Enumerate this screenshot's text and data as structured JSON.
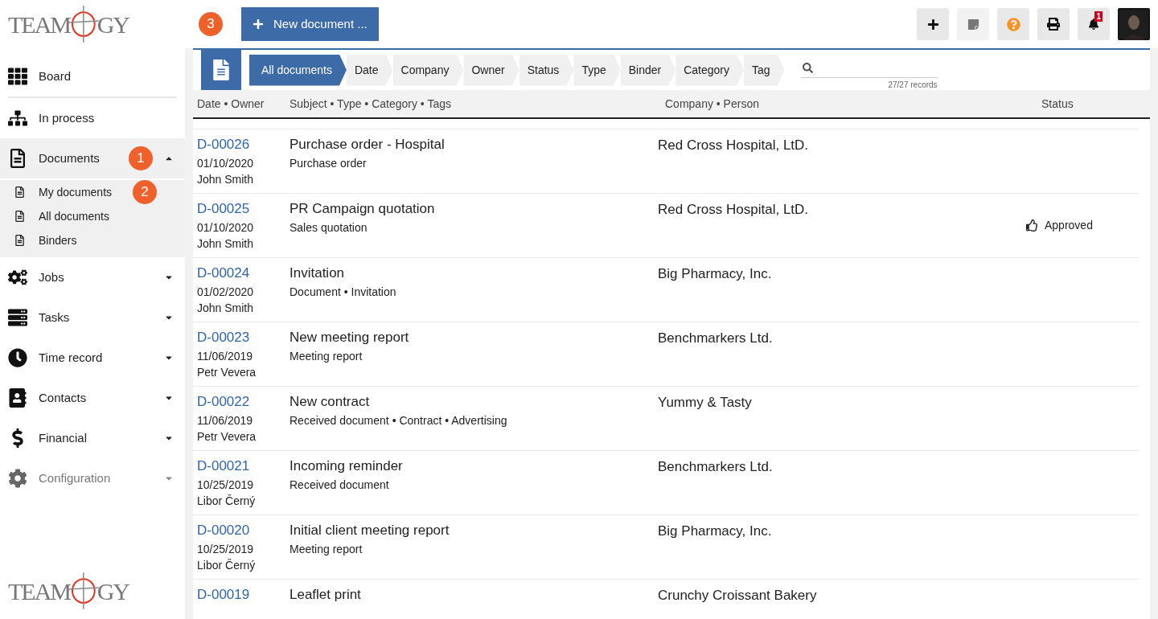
{
  "logo": {
    "left": "TEAM",
    "right": "GY"
  },
  "sidebar": {
    "items": [
      {
        "label": "Board",
        "selected": false
      },
      {
        "label": "In process",
        "selected": false
      },
      {
        "label": "Documents",
        "selected": true,
        "expanded": true,
        "badge": "1",
        "children": [
          {
            "label": "My documents",
            "badge": "2"
          },
          {
            "label": "All documents"
          },
          {
            "label": "Binders"
          }
        ]
      },
      {
        "label": "Jobs",
        "selected": false,
        "expanded": false
      },
      {
        "label": "Tasks",
        "selected": false,
        "expanded": false
      },
      {
        "label": "Time record",
        "selected": false,
        "expanded": false
      },
      {
        "label": "Contacts",
        "selected": false,
        "expanded": false
      },
      {
        "label": "Financial",
        "selected": false,
        "expanded": false
      },
      {
        "label": "Configuration",
        "selected": false,
        "expanded": false,
        "disabled": true
      }
    ]
  },
  "footer_logo": {
    "left": "TEAM",
    "right": "GY"
  },
  "toolbar": {
    "badge": "3",
    "new_button": "New document ...",
    "notifications": "1"
  },
  "filters": [
    {
      "label": "All documents",
      "selected": true
    },
    {
      "label": "Date",
      "selected": false
    },
    {
      "label": "Company",
      "selected": false
    },
    {
      "label": "Owner",
      "selected": false
    },
    {
      "label": "Status",
      "selected": false
    },
    {
      "label": "Type",
      "selected": false
    },
    {
      "label": "Binder",
      "selected": false
    },
    {
      "label": "Category",
      "selected": false
    },
    {
      "label": "Tag",
      "selected": false
    }
  ],
  "records": "27/27 records",
  "table": {
    "columns": [
      "Date • Owner",
      "Subject • Type • Category • Tags",
      "Company • Person",
      "Status"
    ],
    "rows": [
      {
        "id": "D-00026",
        "date": "01/10/2020",
        "owner": "John Smith",
        "subject": "Purchase order - Hospital",
        "type": "Purchase order",
        "company": "Red Cross Hospital, LtD."
      },
      {
        "id": "D-00025",
        "date": "01/10/2020",
        "owner": "John Smith",
        "subject": "PR Campaign quotation",
        "type": "Sales quotation",
        "company": "Red Cross Hospital, LtD.",
        "status": {
          "kind": "approved",
          "label": "Approved"
        }
      },
      {
        "id": "D-00024",
        "date": "01/02/2020",
        "owner": "John Smith",
        "subject": "Invitation",
        "type": "Document • Invitation",
        "company": "Big Pharmacy, Inc."
      },
      {
        "id": "D-00023",
        "date": "11/06/2019",
        "owner": "Petr Vevera",
        "subject": "New meeting report",
        "type": "Meeting report",
        "company": "Benchmarkers Ltd."
      },
      {
        "id": "D-00022",
        "date": "11/06/2019",
        "owner": "Petr Vevera",
        "subject": "New contract",
        "type": "Received document • Contract • Advertising",
        "company": "Yummy & Tasty"
      },
      {
        "id": "D-00021",
        "date": "10/25/2019",
        "owner": "Libor Černý",
        "subject": "Incoming reminder",
        "type": "Received document",
        "company": "Benchmarkers Ltd."
      },
      {
        "id": "D-00020",
        "date": "10/25/2019",
        "owner": "Libor Černý",
        "subject": "Initial client meeting report",
        "type": "Meeting report",
        "company": "Big Pharmacy, Inc."
      },
      {
        "id": "D-00019",
        "subject": "Leaflet print",
        "company": "Crunchy Croissant Bakery"
      }
    ]
  }
}
